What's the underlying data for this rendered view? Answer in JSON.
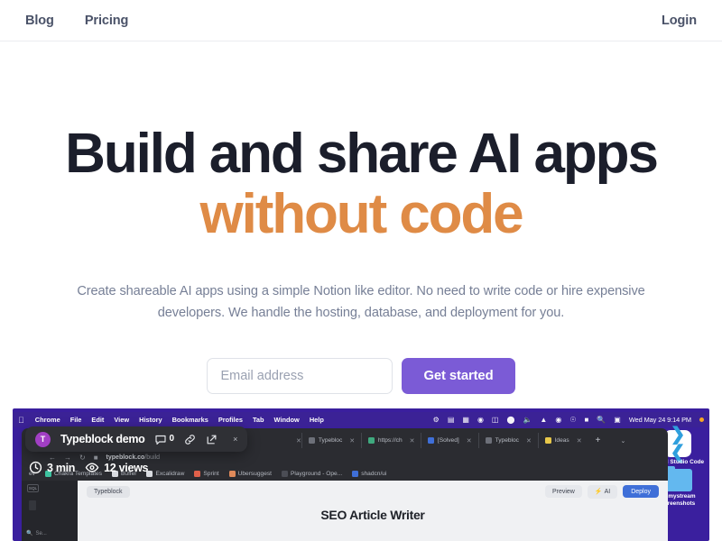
{
  "nav": {
    "links": [
      {
        "label": "Blog",
        "name": "nav-link-blog"
      },
      {
        "label": "Pricing",
        "name": "nav-link-pricing"
      }
    ],
    "login_label": "Login"
  },
  "hero": {
    "headline_line1": "Build and share AI apps",
    "headline_line2": "without code",
    "accent_color": "#df8b46",
    "headline_color": "#1b1e2b",
    "subtitle": "Create shareable AI apps using a simple Notion like editor. No need to write code or hire expensive developers. We handle the hosting, database, and deployment for you."
  },
  "signup": {
    "email_placeholder": "Email address",
    "email_value": "",
    "cta_label": "Get started",
    "cta_color": "#7b5bd6"
  },
  "demo": {
    "macos": {
      "apple_glyph": "●",
      "menus": [
        "Chrome",
        "File",
        "Edit",
        "View",
        "History",
        "Bookmarks",
        "Profiles",
        "Tab",
        "Window",
        "Help"
      ],
      "status_icons": [
        "gear-icon",
        "stats-icon",
        "hd-icon",
        "at-icon",
        "keyboard-icon",
        "shield-icon",
        "volume-icon",
        "dropbox-icon",
        "wifi-icon",
        "clock-icon",
        "battery-icon",
        "search-icon",
        "control-center-icon"
      ],
      "clock": "Wed May 24  9:14 PM"
    },
    "desktop_icons": [
      {
        "label": "Visual Studio Code",
        "name": "desktop-icon-vscode"
      },
      {
        "label": "Ohmystream Screenshots",
        "name": "desktop-icon-folder"
      }
    ],
    "browser": {
      "tabs": [
        {
          "label": "Typebloc",
          "fav": "#6d7079"
        },
        {
          "label": "https://ch",
          "fav": "#3fa97e"
        },
        {
          "label": "[Solved]",
          "fav": "#3f6fd8"
        },
        {
          "label": "Typebloc",
          "fav": "#6d7079"
        },
        {
          "label": "Ideas",
          "fav": "#e8c84a"
        }
      ],
      "new_tab": "+",
      "tab_list_chevron": "⌄",
      "url_prefix": "typeblock.co",
      "url_suffix": "/build",
      "bookmarks": [
        {
          "label": "ev",
          "color": "#2b2c31"
        },
        {
          "label": "Chakra Templates",
          "color": "#3dc2a0"
        },
        {
          "label": "Buffer",
          "color": "#2b2c31"
        },
        {
          "label": "Excalidraw",
          "color": "#d9dbe0"
        },
        {
          "label": "Sprint",
          "color": "#e0604a"
        },
        {
          "label": "Ubersuggest",
          "color": "#e08a5a"
        },
        {
          "label": "Playground - Ope...",
          "color": "#4b4d55"
        },
        {
          "label": "shadcn/ui",
          "color": "#3f6fd8"
        }
      ]
    },
    "app": {
      "sidebar_chip": "SQL",
      "sidebar_search": "Se...",
      "brand_badge": "Typeblock",
      "preview_label": "Preview",
      "ai_label": "AI",
      "ai_bolt": "⚡",
      "deploy_label": "Deploy",
      "document_title": "SEO Article Writer"
    },
    "overlay": {
      "avatar_initial": "T",
      "title": "Typeblock demo",
      "comment_count": "0",
      "close_glyph": "×",
      "duration": "3 min",
      "views": "12 views"
    }
  }
}
